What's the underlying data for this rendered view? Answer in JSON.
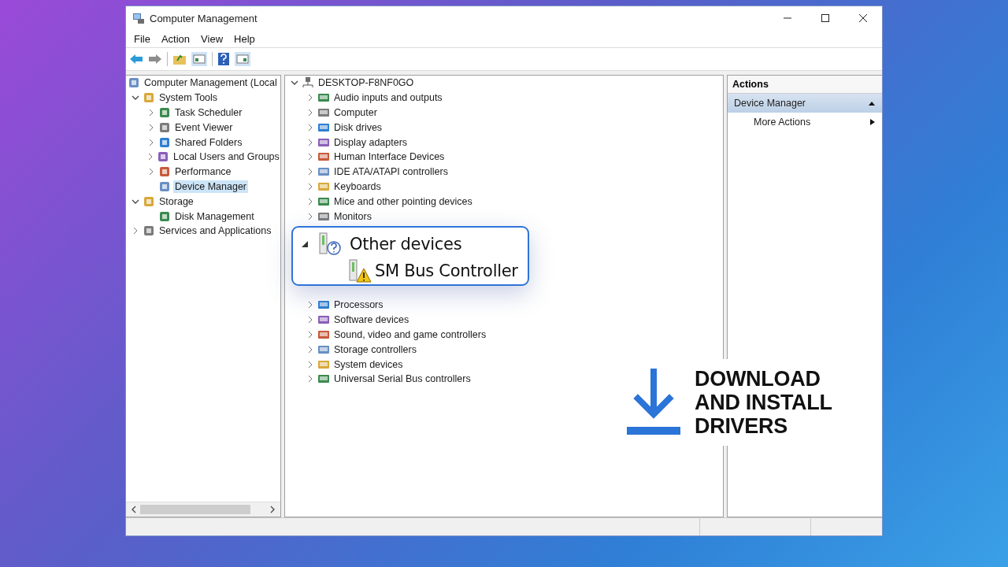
{
  "window": {
    "title": "Computer Management"
  },
  "menu": [
    "File",
    "Action",
    "View",
    "Help"
  ],
  "left_tree": {
    "label": "Computer Management (Local",
    "selected": false,
    "children": [
      {
        "label": "System Tools",
        "expanded": true,
        "selected": false,
        "children": [
          {
            "label": "Task Scheduler",
            "expanded": false,
            "selected": false
          },
          {
            "label": "Event Viewer",
            "expanded": false,
            "selected": false
          },
          {
            "label": "Shared Folders",
            "expanded": false,
            "selected": false
          },
          {
            "label": "Local Users and Groups",
            "expanded": false,
            "selected": false
          },
          {
            "label": "Performance",
            "expanded": false,
            "selected": false
          },
          {
            "label": "Device Manager",
            "selected": true
          }
        ]
      },
      {
        "label": "Storage",
        "expanded": true,
        "selected": false,
        "children": [
          {
            "label": "Disk Management",
            "selected": false
          }
        ]
      },
      {
        "label": "Services and Applications",
        "expanded": false,
        "selected": false
      }
    ]
  },
  "device_tree": {
    "label": "DESKTOP-F8NF0GO",
    "expanded": true,
    "above": [
      "Audio inputs and outputs",
      "Computer",
      "Disk drives",
      "Display adapters",
      "Human Interface Devices",
      "IDE ATA/ATAPI controllers",
      "Keyboards",
      "Mice and other pointing devices",
      "Monitors"
    ],
    "below": [
      "Processors",
      "Software devices",
      "Sound, video and game controllers",
      "Storage controllers",
      "System devices",
      "Universal Serial Bus controllers"
    ]
  },
  "callout": {
    "label": "Other devices",
    "expanded": true,
    "child": "SM Bus Controller"
  },
  "actions": {
    "header": "Actions",
    "items": [
      {
        "label": "Device Manager",
        "kind": "section",
        "selected": true
      },
      {
        "label": "More Actions",
        "kind": "submenu",
        "selected": false
      }
    ]
  },
  "promo": {
    "lines": [
      "DOWNLOAD",
      "AND INSTALL",
      "DRIVERS"
    ]
  }
}
